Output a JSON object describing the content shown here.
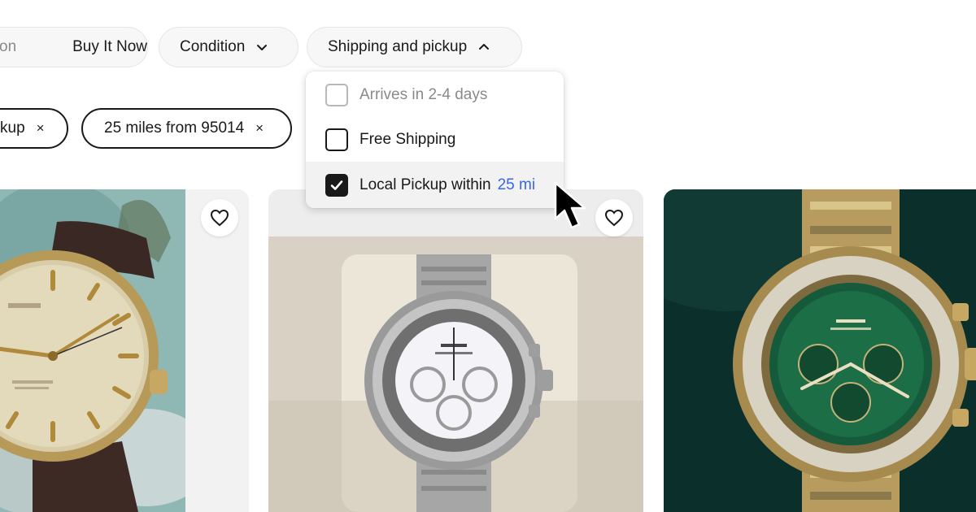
{
  "filters": {
    "auction_partial": "on",
    "buy_it_now": "Buy It Now",
    "condition": "Condition",
    "shipping_pickup": "Shipping and pickup"
  },
  "applied_chips": [
    {
      "label": "kup",
      "remove": "×"
    },
    {
      "label": "25 miles from 95014",
      "remove": "×"
    }
  ],
  "dropdown": {
    "options": [
      {
        "label": "Arrives in 2-4 days",
        "checked": false,
        "disabled": true
      },
      {
        "label": "Free Shipping",
        "checked": false,
        "disabled": false
      },
      {
        "label": "Local Pickup within",
        "link": "25 mi",
        "checked": true,
        "disabled": false
      }
    ]
  },
  "listings": [
    {
      "image": "vintage gold watch on brown leather strap",
      "favorite_icon": "heart-icon"
    },
    {
      "image": "steel chronograph with white dial in box",
      "favorite_icon": "heart-icon"
    },
    {
      "image": "two-tone chronograph with green dial",
      "favorite_icon": "heart-icon"
    }
  ],
  "colors": {
    "link_blue": "#3665f3",
    "text_dark": "#191919",
    "pill_bg": "#f7f7f7",
    "muted": "#8a8a8a"
  }
}
